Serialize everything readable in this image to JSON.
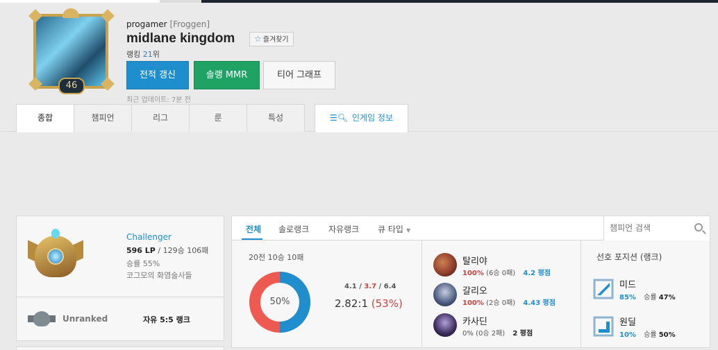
{
  "profile": {
    "level": "46",
    "prev_name_label": "progamer",
    "prev_name": "[Froggen]",
    "summoner_name": "midlane kingdom",
    "favorite_label": "즐겨찾기",
    "ranking_prefix": "랭킹",
    "ranking_value": "21",
    "ranking_suffix": "위",
    "buttons": {
      "renew": "전적 갱신",
      "mmr": "솔랭 MMR",
      "tier_graph": "티어 그래프"
    },
    "last_updated": "최근 업데이트: 7분 전"
  },
  "tabs": [
    "종합",
    "챔피언",
    "리그",
    "룬",
    "특성"
  ],
  "ingame_tab": "인게임 정보",
  "rank_solo": {
    "tier": "Challenger",
    "lp": "596 LP",
    "record": "/ 129승 106패",
    "winrate": "승률 55%",
    "league": "코그모의 화염술사들"
  },
  "rank_flex": {
    "tier": "Unranked",
    "queue": "자유 5:5 랭크"
  },
  "stats": {
    "queue_tabs": [
      "전체",
      "솔로랭크",
      "자유랭크",
      "큐 타입"
    ],
    "search_placeholder": "챔피언 검색",
    "summary": "20전 10승 10패",
    "winrate_pct": 50,
    "winrate_label": "50%",
    "kills": "4.1",
    "deaths": "3.7",
    "assists": "6.4",
    "kda_ratio": "2.82:1",
    "kda_winrate": "(53%)",
    "champions": [
      {
        "name": "탈리야",
        "winrate": "100%",
        "record": "(6승 0패)",
        "kda": "4.2 평점",
        "color": "#8a3a2a"
      },
      {
        "name": "갈리오",
        "winrate": "100%",
        "record": "(2승 0패)",
        "kda": "4.43 평점",
        "color": "#4a5a80"
      },
      {
        "name": "카사딘",
        "winrate": "0%",
        "record": "(0승 2패)",
        "kda": "2 평점",
        "color": "#3a2a5a"
      }
    ],
    "position_title": "선호 포지션 (랭크)",
    "positions": [
      {
        "name": "미드",
        "share": "85%",
        "winrate_label": "승률",
        "winrate": "47%"
      },
      {
        "name": "원딜",
        "share": "10%",
        "winrate_label": "승률",
        "winrate": "50%"
      }
    ]
  },
  "colors": {
    "accent_blue": "#1f8ecd",
    "accent_green": "#1ea365",
    "loss_red": "#ee5a52",
    "win_blue": "#1f8ecd"
  }
}
